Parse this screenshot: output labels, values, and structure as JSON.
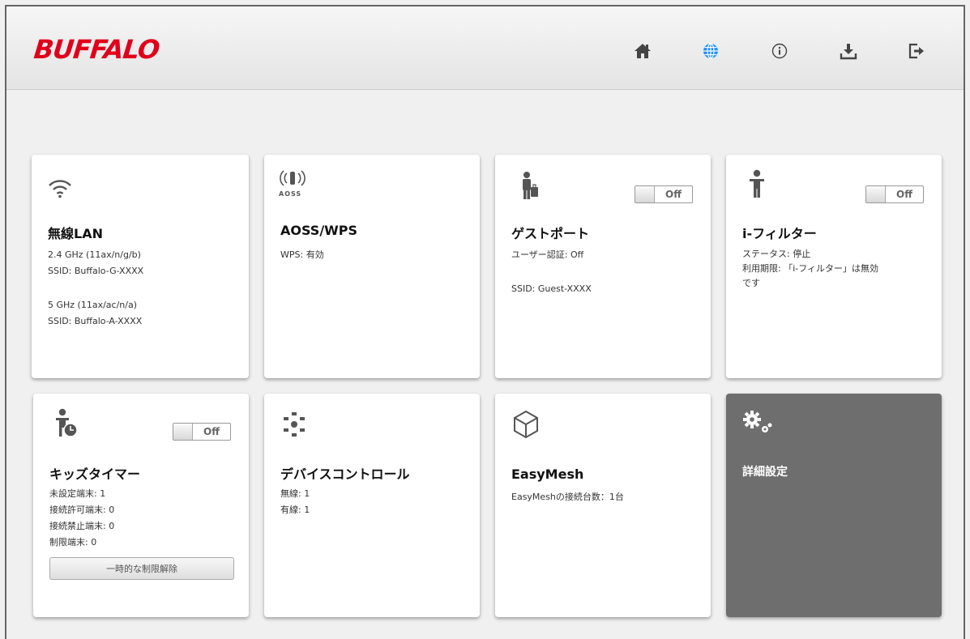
{
  "header": {
    "logo": "BUFFALO",
    "nav": [
      "home-icon",
      "globe-icon",
      "info-icon",
      "download-icon",
      "logout-icon"
    ],
    "accent": "#1e90ff"
  },
  "cards": {
    "wireless": {
      "title": "無線LAN",
      "band1": "2.4 GHz (11ax/n/g/b)",
      "ssid1": "SSID: Buffalo-G-XXXX",
      "band2": "5 GHz (11ax/ac/n/a)",
      "ssid2": "SSID: Buffalo-A-XXXX"
    },
    "aoss": {
      "icon_text": "AOSS",
      "title": "AOSS/WPS",
      "wps": "WPS: 有効"
    },
    "guest": {
      "title": "ゲストポート",
      "auth": "ユーザー認証: Off",
      "ssid": "SSID: Guest-XXXX",
      "toggle": "Off"
    },
    "ifilter": {
      "title": "i-フィルター",
      "status": "ステータス: 停止",
      "period1": "利用期限: 「i-フィルター」は無効",
      "period2": "です",
      "toggle": "Off"
    },
    "kids": {
      "title": "キッズタイマー",
      "unset": "未設定端末: 1",
      "allowed": "接続許可端末: 0",
      "blocked": "接続禁止端末: 0",
      "limited": "制限端末: 0",
      "button": "一時的な制限解除",
      "toggle": "Off"
    },
    "device": {
      "title": "デバイスコントロール",
      "wireless": "無線: 1",
      "wired": "有線: 1"
    },
    "easymesh": {
      "title": "EasyMesh",
      "count": "EasyMeshの接続台数：1台"
    },
    "advanced": {
      "title": "詳細設定"
    }
  }
}
